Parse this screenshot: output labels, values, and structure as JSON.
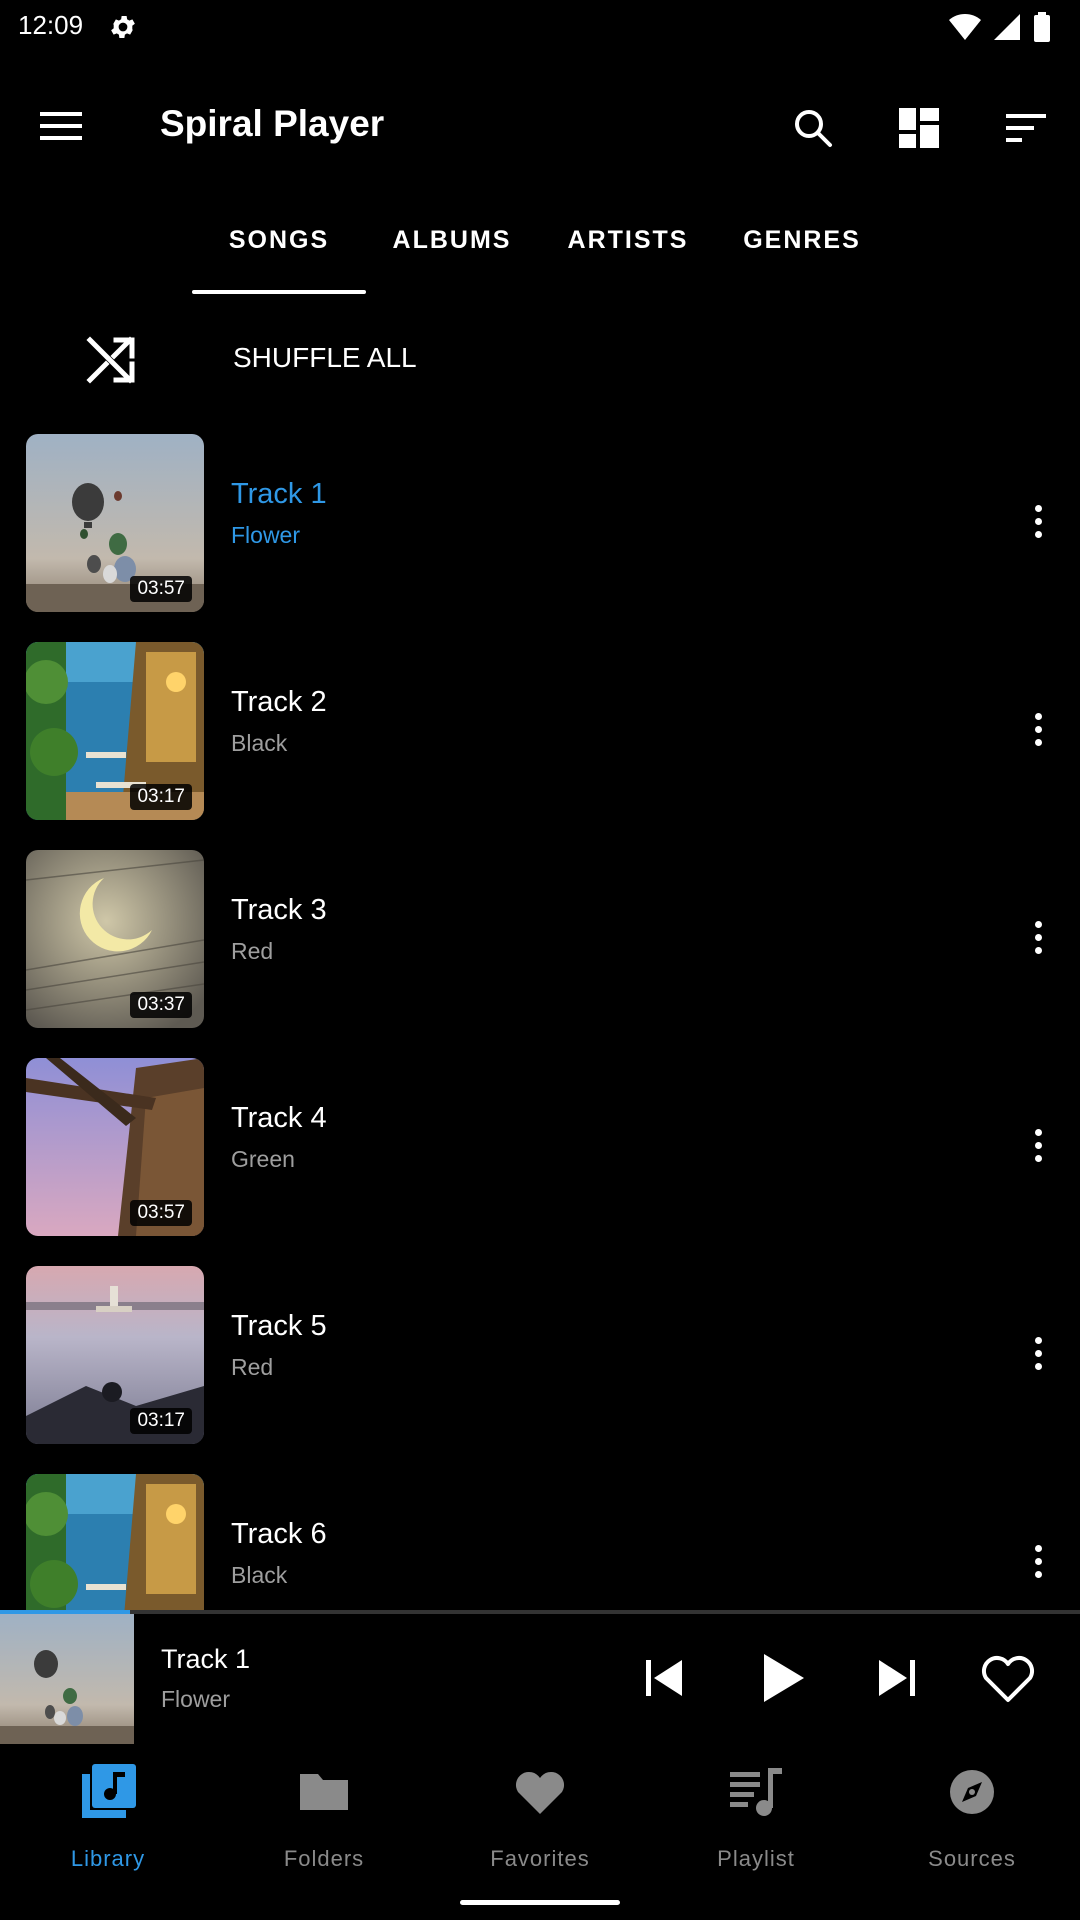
{
  "status_bar": {
    "time": "12:09",
    "icons": [
      "gear-icon",
      "wifi-icon",
      "signal-icon",
      "battery-icon"
    ]
  },
  "app_bar": {
    "title": "Spiral Player",
    "icons": [
      "menu-icon",
      "search-icon",
      "grid-view-icon",
      "sort-icon"
    ]
  },
  "tabs": [
    {
      "label": "SONGS",
      "selected": true
    },
    {
      "label": "ALBUMS",
      "selected": false
    },
    {
      "label": "ARTISTS",
      "selected": false
    },
    {
      "label": "GENRES",
      "selected": false
    }
  ],
  "shuffle": {
    "label": "SHUFFLE ALL",
    "icon": "shuffle-icon"
  },
  "tracks": [
    {
      "title": "Track 1",
      "artist": "Flower",
      "duration": "03:57",
      "playing": true
    },
    {
      "title": "Track 2",
      "artist": "Black",
      "duration": "03:17"
    },
    {
      "title": "Track 3",
      "artist": "Red",
      "duration": "03:37"
    },
    {
      "title": "Track 4",
      "artist": "Green",
      "duration": "03:57"
    },
    {
      "title": "Track 5",
      "artist": "Red",
      "duration": "03:17"
    },
    {
      "title": "Track 6",
      "artist": "Black"
    }
  ],
  "now_playing": {
    "title": "Track 1",
    "artist": "Flower",
    "progress": 0.12,
    "controls": [
      "previous-icon",
      "play-icon",
      "next-icon",
      "heart-outline-icon"
    ]
  },
  "bottom_nav": [
    {
      "label": "Library",
      "icon": "library-music-icon",
      "active": true
    },
    {
      "label": "Folders",
      "icon": "folder-icon"
    },
    {
      "label": "Favorites",
      "icon": "heart-icon"
    },
    {
      "label": "Playlist",
      "icon": "playlist-icon"
    },
    {
      "label": "Sources",
      "icon": "compass-icon"
    }
  ],
  "colors": {
    "accent": "#2f98e6",
    "background": "#000000",
    "secondary_text": "#9e9e9e",
    "inactive_nav": "#8a8a8a"
  }
}
